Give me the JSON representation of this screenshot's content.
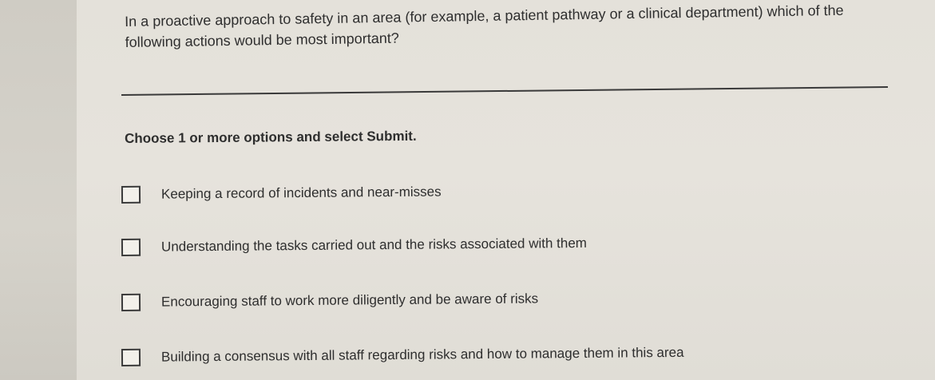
{
  "question": {
    "text": "In a proactive approach to safety in an area (for example, a patient pathway or a clinical department) which of the following actions would be most important?"
  },
  "instruction": "Choose 1 or more options and select Submit.",
  "options": [
    {
      "label": "Keeping a record of incidents and near-misses",
      "checked": false
    },
    {
      "label": "Understanding the tasks carried out and the risks associated with them",
      "checked": false
    },
    {
      "label": "Encouraging staff to work more diligently and be aware of risks",
      "checked": false
    },
    {
      "label": "Building a consensus with all staff regarding risks and how to manage them in this area",
      "checked": false
    }
  ]
}
